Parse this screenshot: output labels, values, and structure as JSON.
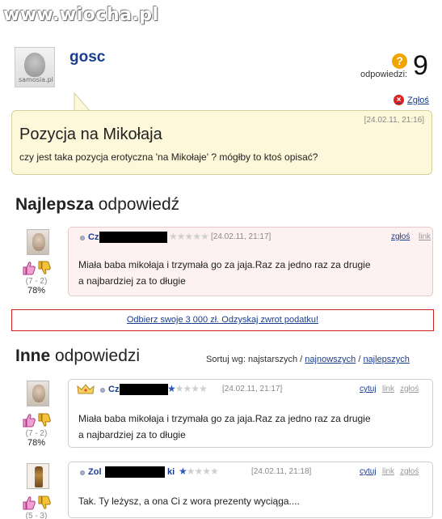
{
  "watermark": "www.wiocha.pl",
  "question": {
    "user": "gosc",
    "avatar_watermark": "samosia.pl",
    "answers_count": "9",
    "answers_label": "odpowiedzi:",
    "answers_icon": "?",
    "report_label": "Zgłoś",
    "date": "[24.02.11, 21:16]",
    "title": "Pozycja na Mikołaja",
    "body": "czy jest taka pozycja erotyczna 'na Mikołaje' ? mógłby to ktoś opisać?"
  },
  "best": {
    "heading_bold": "Najlepsza",
    "heading_rest": " odpowiedź",
    "answer": {
      "user_visible": "Cz",
      "date": "[24.02.11, 21:17]",
      "report_label": "zgłoś",
      "link_label": "link",
      "body_line1": "Miała baba mikołaja i trzymała go za jaja.Raz za jedno raz za drugie",
      "body_line2": "a najbardziej za to długie",
      "votes": "(7 - 2)",
      "percent": "78%",
      "stars_filled": 0
    }
  },
  "ad": {
    "text": "Odbierz swoje 3 000 zł. Odzyskaj zwrot podatku!"
  },
  "others": {
    "heading_bold": "Inne",
    "heading_rest": " odpowiedzi",
    "sort_prefix": "Sortuj wg: najstarszych / ",
    "sort_newest": "najnowszych",
    "sort_sep": " / ",
    "sort_best": "najlepszych",
    "answers": [
      {
        "user_visible": "Cz",
        "date": "[24.02.11, 21:17]",
        "quote_label": "cytuj",
        "link_label": "link",
        "report_label": "zgłoś",
        "body_line1": "Miała baba mikołaja i trzymała go za jaja.Raz za jedno raz za drugie",
        "body_line2": "a najbardziej za to długie",
        "votes": "(7 - 2)",
        "percent": "78%",
        "stars_filled": 1
      },
      {
        "user_visible_a": "Zol",
        "user_visible_b": "ki",
        "date": "[24.02.11, 21:18]",
        "quote_label": "cytuj",
        "link_label": "link",
        "report_label": "zgłoś",
        "body_line1": "Tak. Ty leżysz, a ona Ci z wora prezenty wyciąga....",
        "votes": "(5 - 3)",
        "stars_filled": 1
      }
    ]
  },
  "colors": {
    "link": "#1a3d8f",
    "question_bg": "#fcf8d9",
    "best_bg": "#fdf1f1",
    "ad_border": "#cc2222",
    "star_on": "#2d58b8"
  }
}
